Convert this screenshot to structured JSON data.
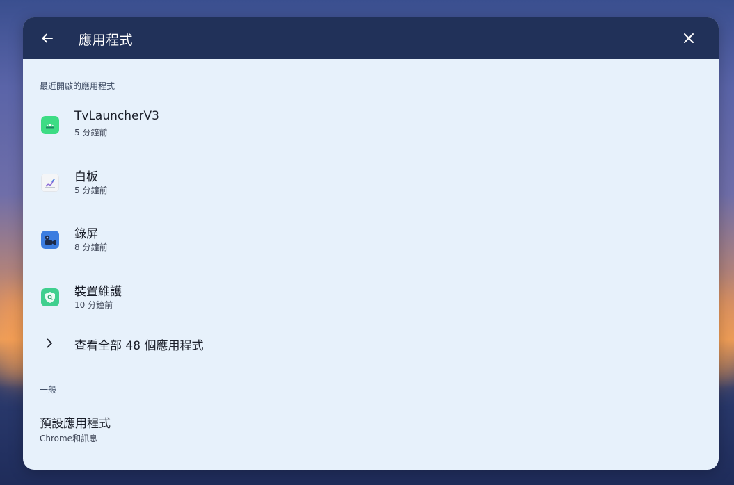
{
  "header": {
    "title": "應用程式"
  },
  "recent": {
    "section_label": "最近開啟的應用程式",
    "apps": [
      {
        "name": "TvLauncherV3",
        "time": "5 分鐘前",
        "icon": "android-icon"
      },
      {
        "name": "白板",
        "time": "5 分鐘前",
        "icon": "whiteboard-icon"
      },
      {
        "name": "錄屏",
        "time": "8 分鐘前",
        "icon": "screen-recorder-icon"
      },
      {
        "name": "裝置維護",
        "time": "10 分鐘前",
        "icon": "device-care-icon"
      }
    ],
    "see_all_label": "查看全部 48 個應用程式"
  },
  "general": {
    "section_label": "一般",
    "default_apps_title": "預設應用程式",
    "default_apps_subtitle": "Chrome和訊息"
  },
  "colors": {
    "header_bg": "#213159",
    "panel_bg": "#e7f1fb"
  }
}
